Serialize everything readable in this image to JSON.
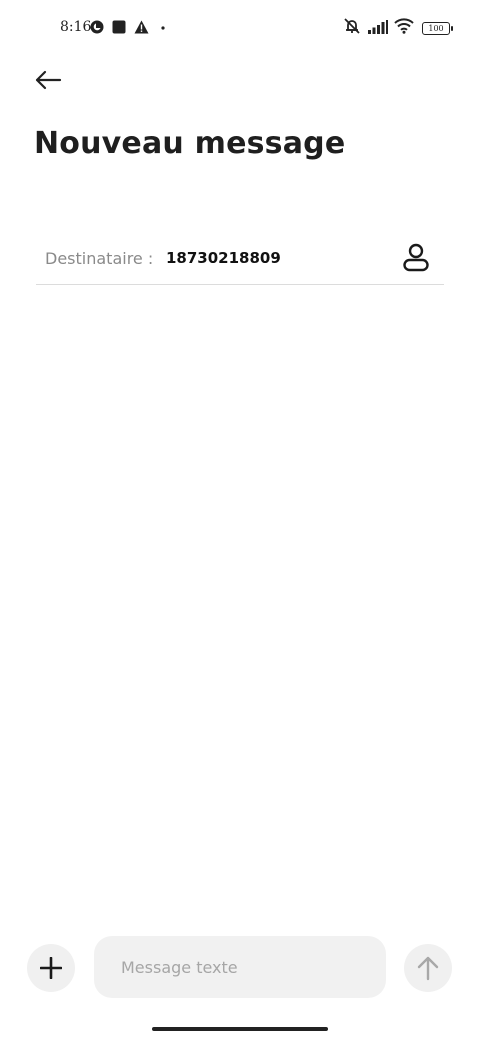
{
  "status_bar": {
    "time": "8:16",
    "battery_level": "100",
    "left_icons": [
      "data-saver-icon",
      "stop-square-icon",
      "warning-icon",
      "dot-icon"
    ],
    "right_icons": [
      "mute-vibrate-icon",
      "signal-icon",
      "wifi-icon",
      "battery-icon"
    ]
  },
  "header": {
    "back_icon": "back-arrow-icon",
    "title": "Nouveau message"
  },
  "recipient": {
    "label": "Destinataire :",
    "value": "18730218809",
    "contact_icon": "contact-person-icon"
  },
  "composer": {
    "add_icon": "plus-icon",
    "placeholder": "Message texte",
    "send_icon": "send-arrow-up-icon"
  },
  "colors": {
    "background": "#ffffff",
    "input_background": "#f1f1f1",
    "label_gray": "#8a8a8a",
    "text_dark": "#1f1f1f"
  }
}
